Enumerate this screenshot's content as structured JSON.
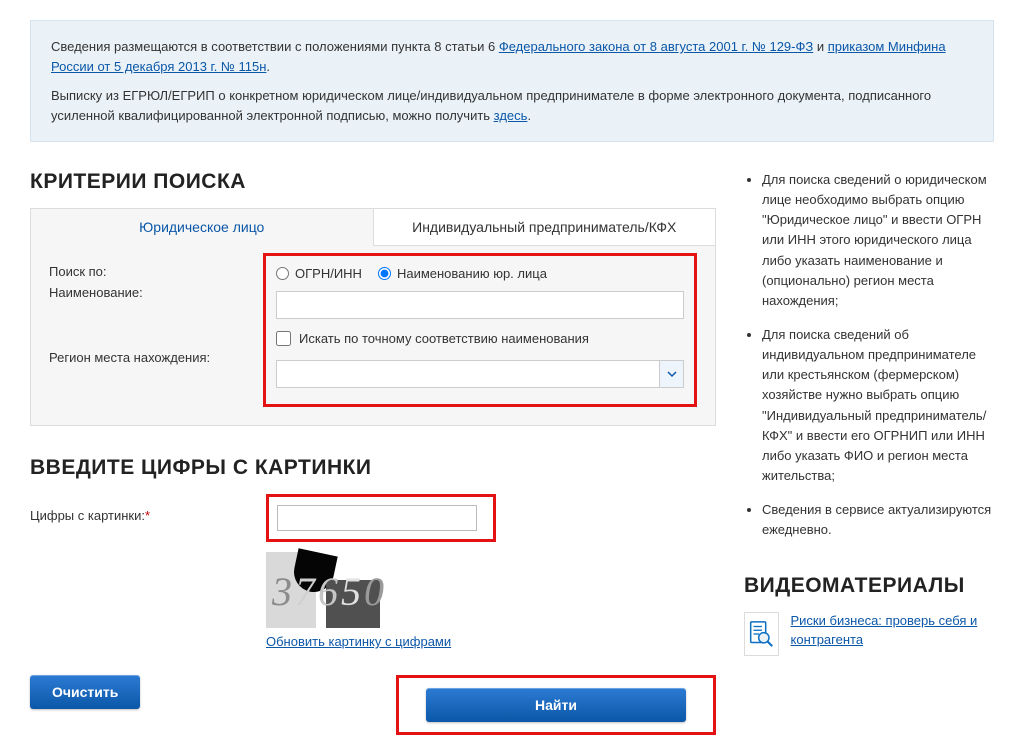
{
  "notice": {
    "p1_a": "Сведения размещаются в соответствии с положениями пункта 8 статьи 6 ",
    "link1": "Федерального закона от 8 августа 2001 г. № 129-ФЗ",
    "p1_b": " и ",
    "link2": "приказом Минфина России от 5 декабря 2013 г. № 115н",
    "p1_c": ".",
    "p2_a": "Выписку из ЕГРЮЛ/ЕГРИП о конкретном юридическом лице/индивидуальном предпринимателе в форме электронного документа, подписанного усиленной квалифицированной электронной подписью, можно получить ",
    "link3": "здесь",
    "p2_b": "."
  },
  "criteria": {
    "heading": "КРИТЕРИИ ПОИСКА",
    "tabs": {
      "legal": "Юридическое лицо",
      "indiv": "Индивидуальный предприниматель/КФХ"
    },
    "labels": {
      "search_by": "Поиск по:",
      "name": "Наименование:",
      "region": "Регион места нахождения:"
    },
    "radios": {
      "ogrn": "ОГРН/ИНН",
      "by_name": "Наименованию юр. лица"
    },
    "exact_check": "Искать по точному соответствию наименования"
  },
  "captcha": {
    "heading": "ВВЕДИТЕ ЦИФРЫ С КАРТИНКИ",
    "label": "Цифры с картинки:",
    "digits": "37650",
    "refresh": "Обновить картинку с цифрами"
  },
  "buttons": {
    "clear": "Очистить",
    "find": "Найти"
  },
  "sidebar": {
    "items": [
      "Для поиска сведений о юридическом лице необходимо выбрать опцию \"Юридическое лицо\" и ввести ОГРН или ИНН этого юридического лица либо указать наименование и (опционально) регион места нахождения;",
      "Для поиска сведений об индивидуальном предпринимателе или крестьянском (фермерском) хозяйстве нужно выбрать опцию \"Индивидуальный предприниматель/КФХ\" и ввести его ОГРНИП или ИНН либо указать ФИО и регион места жительства;",
      "Сведения в сервисе актуализируются ежедневно."
    ]
  },
  "video": {
    "heading": "ВИДЕОМАТЕРИАЛЫ",
    "link": "Риски бизнеса: проверь себя и контрагента"
  }
}
